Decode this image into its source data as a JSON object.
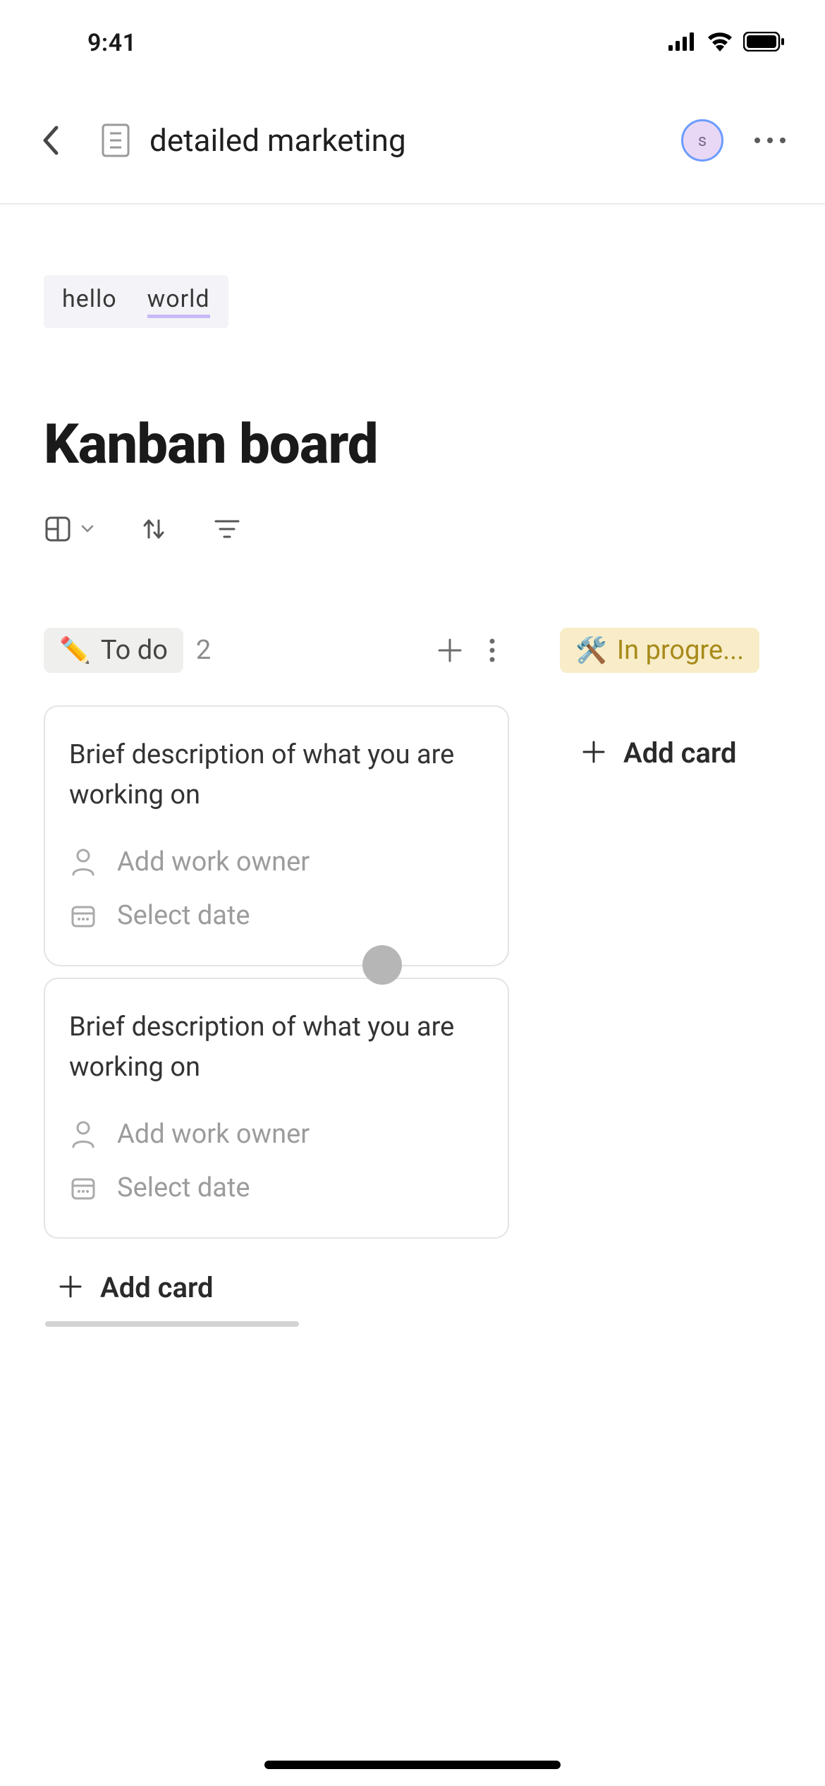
{
  "status": {
    "time": "9:41",
    "avatar_initial": "s"
  },
  "nav": {
    "page_name": "detailed marketing"
  },
  "code": {
    "word1": "hello",
    "word2": "world"
  },
  "page": {
    "title": "Kanban board"
  },
  "board": {
    "columns": [
      {
        "emoji": "✏️",
        "name": "To do",
        "count": "2",
        "add_label": "Add card",
        "cards": [
          {
            "title": "Brief description of what you are working on",
            "owner_label": "Add work owner",
            "date_label": "Select date"
          },
          {
            "title": "Brief description of what you are working on",
            "owner_label": "Add work owner",
            "date_label": "Select date"
          }
        ]
      },
      {
        "emoji": "🛠️",
        "name": "In progre...",
        "add_label": "Add card"
      }
    ]
  }
}
